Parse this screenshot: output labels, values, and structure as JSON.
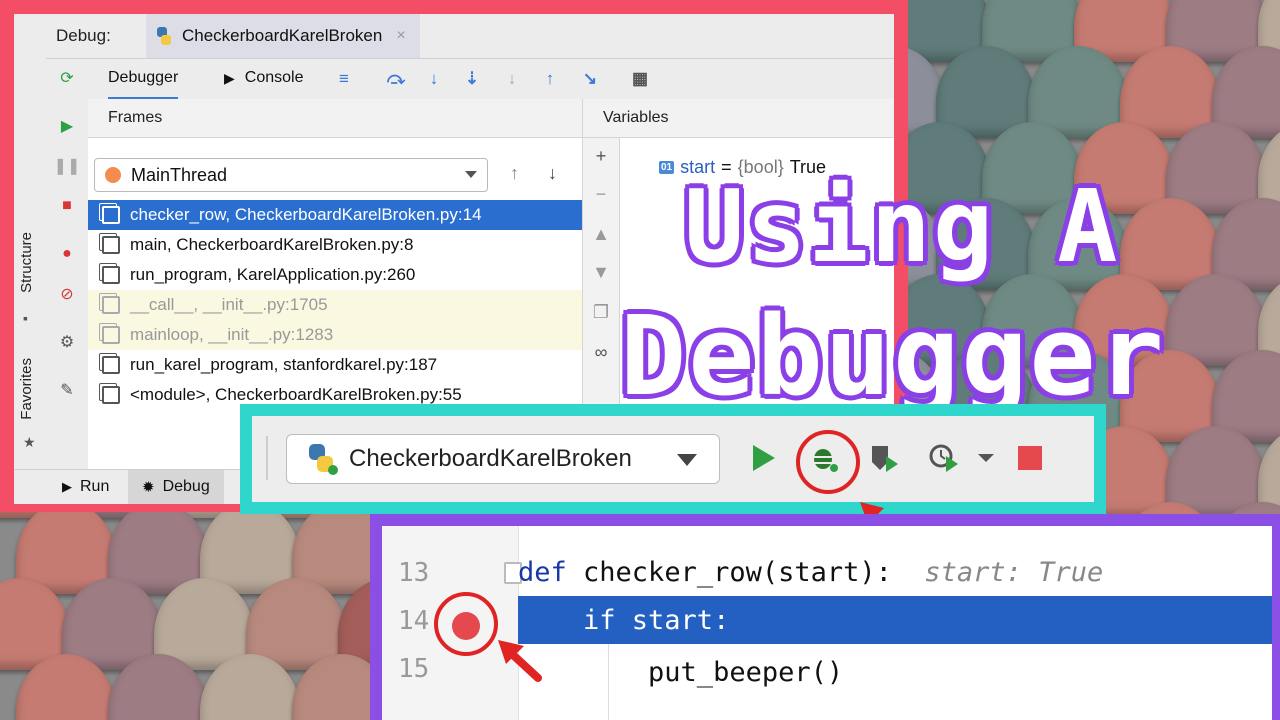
{
  "ide": {
    "title_label": "Debug:",
    "run_tab": "CheckerboardKarelBroken",
    "close_glyph": "×",
    "side_labels": [
      "Structure",
      "Favorites"
    ],
    "tabs": {
      "debugger": "Debugger",
      "console": "Console"
    },
    "frames_header": "Frames",
    "variables_header": "Variables",
    "thread": "MainThread",
    "frames": [
      "checker_row, CheckerboardKarelBroken.py:14",
      "main, CheckerboardKarelBroken.py:8",
      "run_program, KarelApplication.py:260",
      "__call__, __init__.py:1705",
      "mainloop, __init__.py:1283",
      "run_karel_program, stanfordkarel.py:187",
      "<module>, CheckerboardKarelBroken.py:55"
    ],
    "variable": {
      "badge": "01",
      "name": "start",
      "eq": " = ",
      "type": "{bool}",
      "value": "True"
    },
    "bottom_tabs": {
      "run": "Run",
      "debug": "Debug"
    },
    "accent": "#2a6fd0",
    "frame_color": "#f44e67"
  },
  "overlay": {
    "line1": "Using A",
    "line2": "Debugger",
    "outline_color": "#8b3fe6"
  },
  "run_toolbar": {
    "config_name": "CheckerboardKarelBroken",
    "frame_color": "#2ed6cc"
  },
  "code": {
    "frame_color": "#8b4fe6",
    "lines": [
      {
        "num": "13",
        "kw": "def",
        "text": " checker_row(start):",
        "hint": "  start: True"
      },
      {
        "num": "14",
        "kw": "",
        "text": "    if start:",
        "hint": ""
      },
      {
        "num": "15",
        "kw": "",
        "text": "        put_beeper()",
        "hint": ""
      }
    ],
    "highlight_color": "#2460c2"
  }
}
